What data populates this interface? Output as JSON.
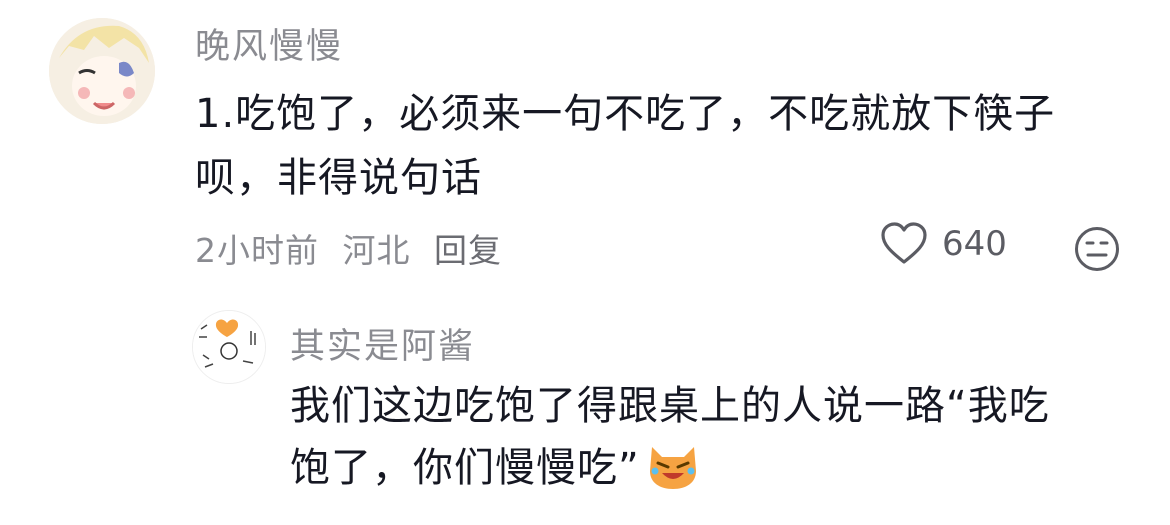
{
  "comment": {
    "author": "晚风慢慢",
    "text_line1": "1.吃饱了，必须来一句不吃了，不吃就放下筷子",
    "text_line2": "呗，非得说句话",
    "time": "2小时前",
    "location": "河北",
    "reply_label": "回复",
    "like_count": "640"
  },
  "reply": {
    "author": "其实是阿酱",
    "text_line1": "我们这边吃饱了得跟桌上的人说一路“我吃",
    "text_line2": "饱了，你们慢慢吃”",
    "emoji": "crying-laughing-cat-emoji"
  },
  "icons": {
    "like": "heart-outline-icon",
    "dislike": "meh-face-icon"
  },
  "colors": {
    "text": "#161823",
    "meta": "#8a8b91",
    "accent_orange": "#f6a342"
  }
}
